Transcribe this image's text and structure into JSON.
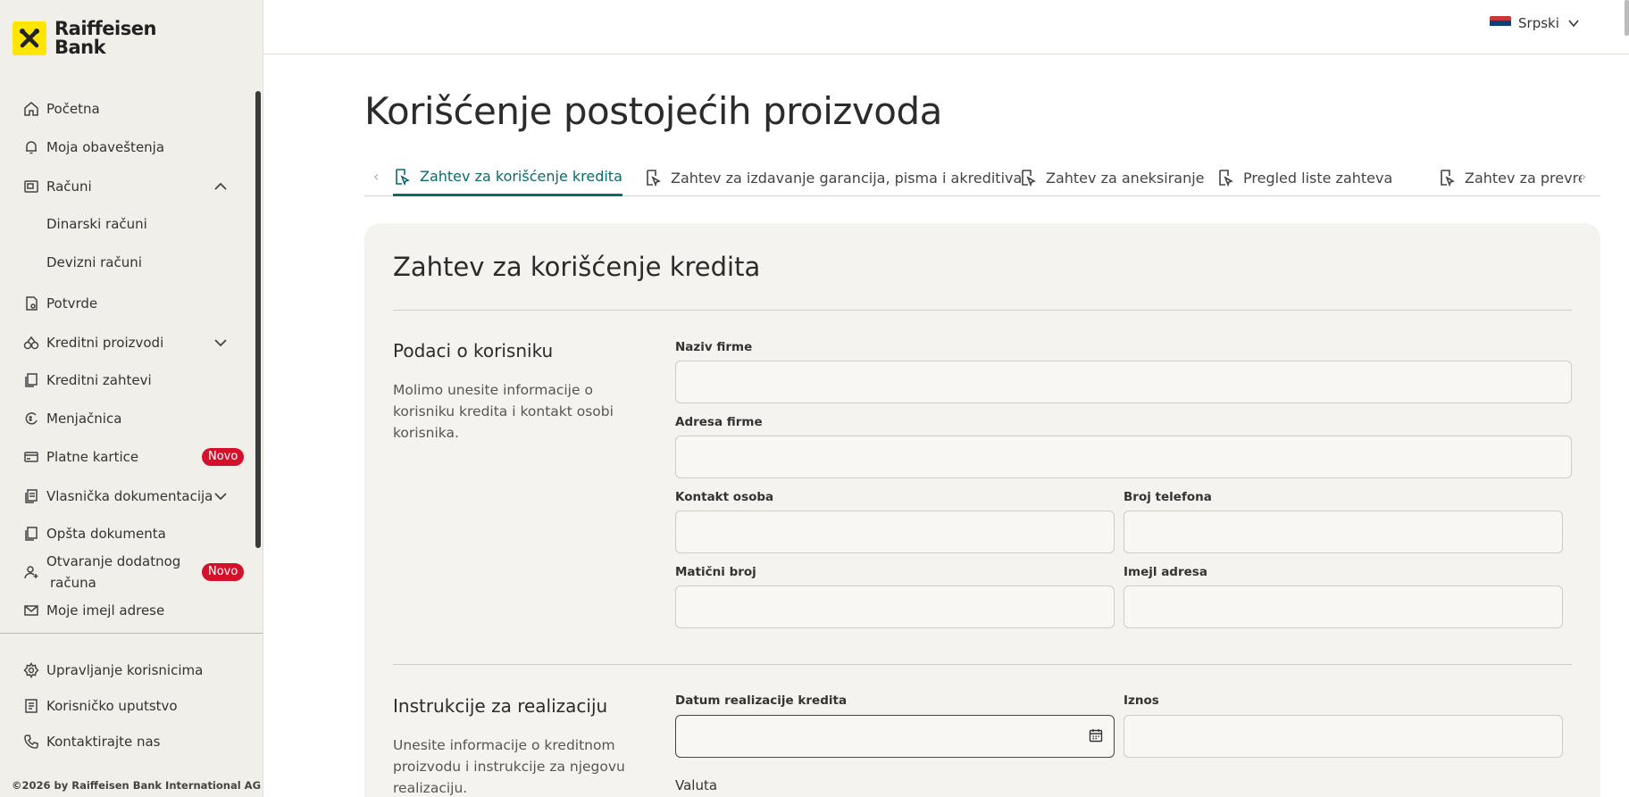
{
  "brand": {
    "line1": "Raiffeisen",
    "line2": "Bank"
  },
  "sidebar": {
    "items": [
      {
        "label": "Početna"
      },
      {
        "label": "Moja obaveštenja"
      },
      {
        "label": "Računi"
      },
      {
        "label": "Dinarski računi"
      },
      {
        "label": "Devizni računi"
      },
      {
        "label": "Potvrde"
      },
      {
        "label": "Kreditni proizvodi"
      },
      {
        "label": "Kreditni zahtevi"
      },
      {
        "label": "Menjačnica"
      },
      {
        "label": "Platne kartice",
        "badge": "Novo"
      },
      {
        "label": "Vlasnička dokumentacija"
      },
      {
        "label": "Opšta dokumenta"
      },
      {
        "label_line1": "Otvaranje dodatnog",
        "label_line2": "računa",
        "badge": "Novo"
      },
      {
        "label": "Moje imejl adrese"
      }
    ],
    "bottom_items": [
      {
        "label": "Upravljanje korisnicima"
      },
      {
        "label": "Korisničko uputstvo"
      },
      {
        "label": "Kontaktirajte nas"
      }
    ],
    "copyright": "©2026 by Raiffeisen Bank International AG"
  },
  "topbar": {
    "language": "Srpski"
  },
  "page": {
    "title": "Korišćenje postojećih proizvoda"
  },
  "tabs": [
    {
      "label": "Zahtev za korišćenje kredita",
      "active": true
    },
    {
      "label": "Zahtev za izdavanje garancija, pisma i akreditiva"
    },
    {
      "label": "Zahtev za aneksiranje"
    },
    {
      "label": "Pregled liste zahteva"
    },
    {
      "label": "Zahtev za prevremen"
    }
  ],
  "form": {
    "title": "Zahtev za korišćenje kredita",
    "section1": {
      "title": "Podaci o korisniku",
      "description": "Molimo unesite informacije o korisniku kredita i kontakt osobi korisnika.",
      "fields": {
        "company_name": {
          "label": "Naziv firme",
          "value": ""
        },
        "company_address": {
          "label": "Adresa firme",
          "value": ""
        },
        "contact_person": {
          "label": "Kontakt osoba",
          "value": ""
        },
        "phone": {
          "label": "Broj telefona",
          "value": ""
        },
        "registration_number": {
          "label": "Matični broj",
          "value": ""
        },
        "email": {
          "label": "Imejl adresa",
          "value": ""
        }
      }
    },
    "section2": {
      "title": "Instrukcije za realizaciju",
      "description": "Unesite informacije o kreditnom proizvodu i instrukcije za njegovu realizaciju.",
      "fields": {
        "realization_date": {
          "label": "Datum realizacije kredita",
          "value": ""
        },
        "amount": {
          "label": "Iznos",
          "value": ""
        },
        "currency": {
          "label": "Valuta"
        }
      }
    }
  },
  "colors": {
    "accent": "#0d6a6a",
    "brand_yellow": "#fee600",
    "badge_red": "#d5102a",
    "sidebar_bg": "#f1efea"
  }
}
